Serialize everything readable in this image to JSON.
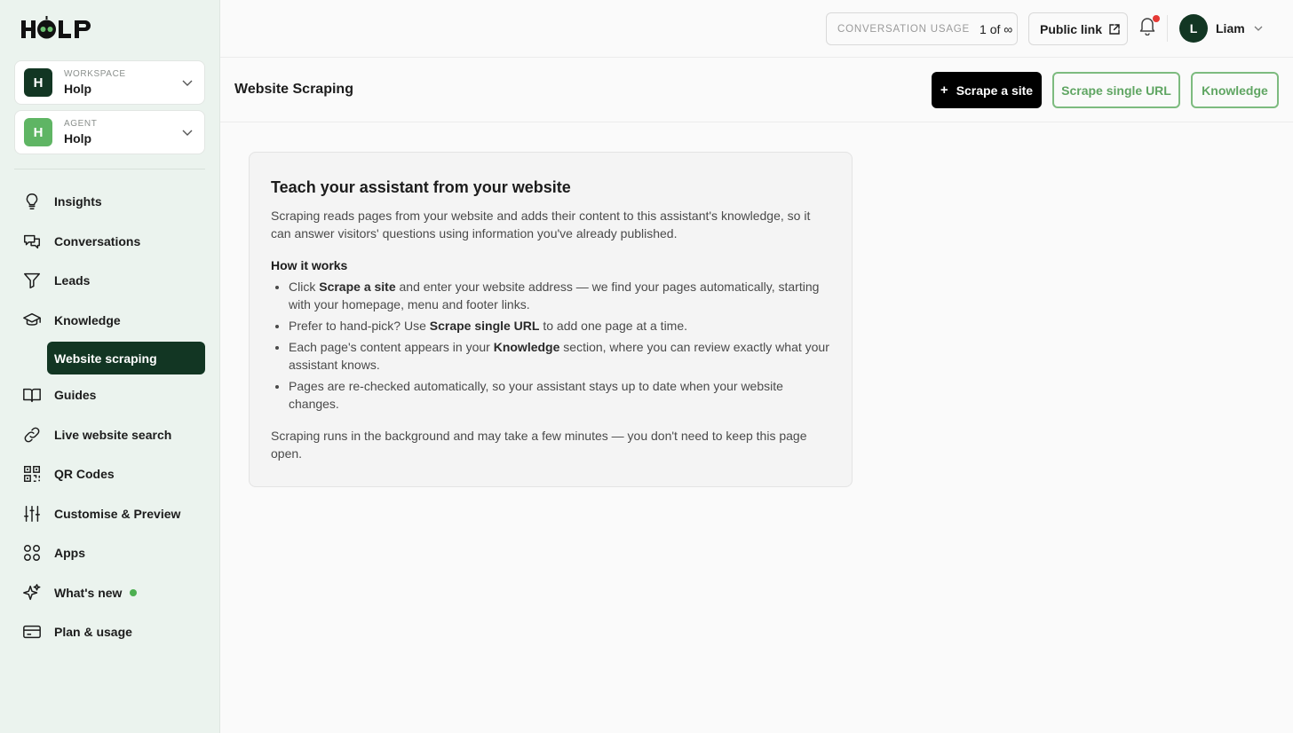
{
  "brand": {
    "logo_text": "HOLP"
  },
  "workspace": {
    "caption": "WORKSPACE",
    "name": "Holp",
    "initial": "H",
    "color": "#123623"
  },
  "agent": {
    "caption": "AGENT",
    "name": "Holp",
    "initial": "H",
    "color": "#5fb564"
  },
  "sidebar": {
    "items": [
      {
        "label": "Insights",
        "icon": "lightbulb-icon"
      },
      {
        "label": "Conversations",
        "icon": "chat-bubbles-icon"
      },
      {
        "label": "Leads",
        "icon": "funnel-icon"
      },
      {
        "label": "Knowledge",
        "icon": "graduation-cap-icon"
      },
      {
        "label": "Guides",
        "icon": "book-icon"
      },
      {
        "label": "Live website search",
        "icon": "link-icon"
      },
      {
        "label": "QR Codes",
        "icon": "qr-code-icon"
      },
      {
        "label": "Customise & Preview",
        "icon": "sliders-icon"
      },
      {
        "label": "Apps",
        "icon": "apps-grid-icon"
      },
      {
        "label": "What's new",
        "icon": "sparkles-icon"
      },
      {
        "label": "Plan & usage",
        "icon": "credit-card-icon"
      }
    ],
    "sub_item": "Website scraping"
  },
  "topbar": {
    "usage_caption": "CONVERSATION USAGE",
    "usage_value": "1 of ∞",
    "public_link": "Public link",
    "user_initial": "L",
    "user_name": "Liam"
  },
  "header": {
    "title": "Website Scraping",
    "scrape_site": "Scrape a site",
    "scrape_single": "Scrape single URL",
    "knowledge": "Knowledge"
  },
  "card": {
    "title": "Teach your assistant from your website",
    "intro": "Scraping reads pages from your website and adds their content to this assistant's knowledge, so it can answer visitors' questions using information you've already published.",
    "how_title": "How it works",
    "b1_pre": "Click ",
    "b1_bold": "Scrape a site",
    "b1_post": " and enter your website address — we find your pages automatically, starting with your homepage, menu and footer links.",
    "b2_pre": "Prefer to hand-pick? Use ",
    "b2_bold": "Scrape single URL",
    "b2_post": " to add one page at a time.",
    "b3_pre": "Each page's content appears in your ",
    "b3_bold": "Knowledge",
    "b3_post": " section, where you can review exactly what your assistant knows.",
    "b4": "Pages are re-checked automatically, so your assistant stays up to date when your website changes.",
    "outro": "Scraping runs in the background and may take a few minutes — you don't need to keep this page open."
  },
  "colors": {
    "accent": "#5fa562",
    "dark_green": "#123623",
    "notification": "#e53935"
  }
}
